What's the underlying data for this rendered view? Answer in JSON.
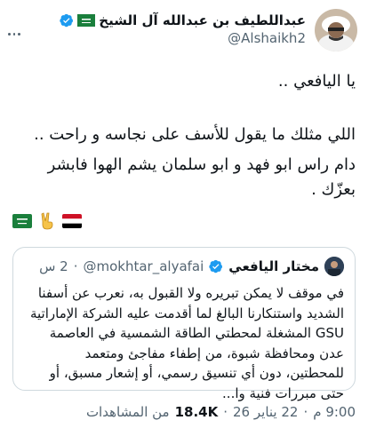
{
  "author": {
    "name": "عبداللطيف بن عبدالله آل الشيخ",
    "handle": "@Alshaikh2",
    "flag": "saudi-flag"
  },
  "tweet": {
    "greeting": "يا اليافعي ..",
    "line1": "اللي مثلك ما يقول للأسف على نجاسه و راحت ..",
    "line2": "دام راس ابو فهد و ابو سلمان يشم الهوا فابشر بعزّك ."
  },
  "emoji_row": [
    "saudi-flag",
    "victory-hand",
    "yemen-flag"
  ],
  "quote": {
    "name": "مختار اليافعي",
    "handle": "@mokhtar_alyafai",
    "dot": "·",
    "time": "2 س",
    "text": "في موقف لا يمكن تبريره ولا القبول به، نعرب عن أسفنا الشديد واستنكارنا البالغ لما أقدمت عليه الشركة الإماراتية GSU المشغلة لمحطتي الطاقة الشمسية في العاصمة عدن ومحافظة شبوة، من إطفاء مفاجئ ومتعمد للمحطتين، دون أي تنسيق رسمي، أو إشعار مسبق، أو حتى مبررات فنية وا..."
  },
  "meta": {
    "time": "9:00 م",
    "sep1": "·",
    "date": "22 يناير 26",
    "sep2": "·",
    "views_count": "18.4K",
    "views_label": "من المشاهدات"
  },
  "colors": {
    "verified": "#1d9bf0",
    "text": "#0f1419",
    "muted": "#536471",
    "border": "#cfd9de"
  }
}
